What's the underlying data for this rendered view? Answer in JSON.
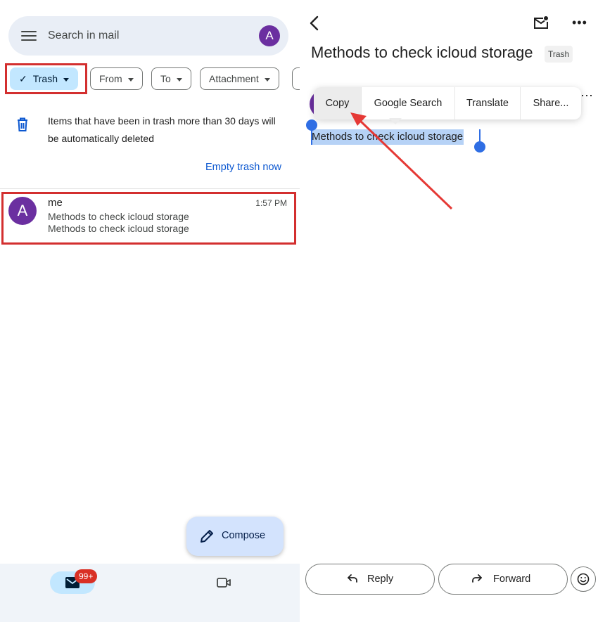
{
  "inbox": {
    "search_placeholder": "Search in mail",
    "account_initial": "A",
    "chips": {
      "trash": "Trash",
      "from": "From",
      "to": "To",
      "attachment": "Attachment"
    },
    "trash_notice": "Items that have been in trash more than 30 days will be automatically deleted",
    "empty_trash": "Empty trash now",
    "mail": {
      "avatar_initial": "A",
      "sender": "me",
      "time": "1:57 PM",
      "subject": "Methods to check icloud storage",
      "snippet": "Methods to check icloud storage"
    },
    "compose_label": "Compose",
    "mail_badge": "99+"
  },
  "detail": {
    "subject": "Methods to check icloud storage",
    "label": "Trash",
    "context_menu": {
      "copy": "Copy",
      "google_search": "Google Search",
      "translate": "Translate",
      "share": "Share..."
    },
    "selected_text": "Methods to check icloud storage",
    "reply_label": "Reply",
    "forward_label": "Forward"
  },
  "colors": {
    "highlight_box": "#d32f2f",
    "avatar": "#6b2fa0",
    "accent_link": "#0b57d0",
    "selection": "#b6d2f6"
  },
  "icons": [
    "menu-icon",
    "check-icon",
    "trash-icon",
    "pencil-icon",
    "mail-icon",
    "video-icon",
    "back-icon",
    "mail-unread-icon",
    "more-icon",
    "reply-icon",
    "forward-icon",
    "emoji-icon"
  ]
}
